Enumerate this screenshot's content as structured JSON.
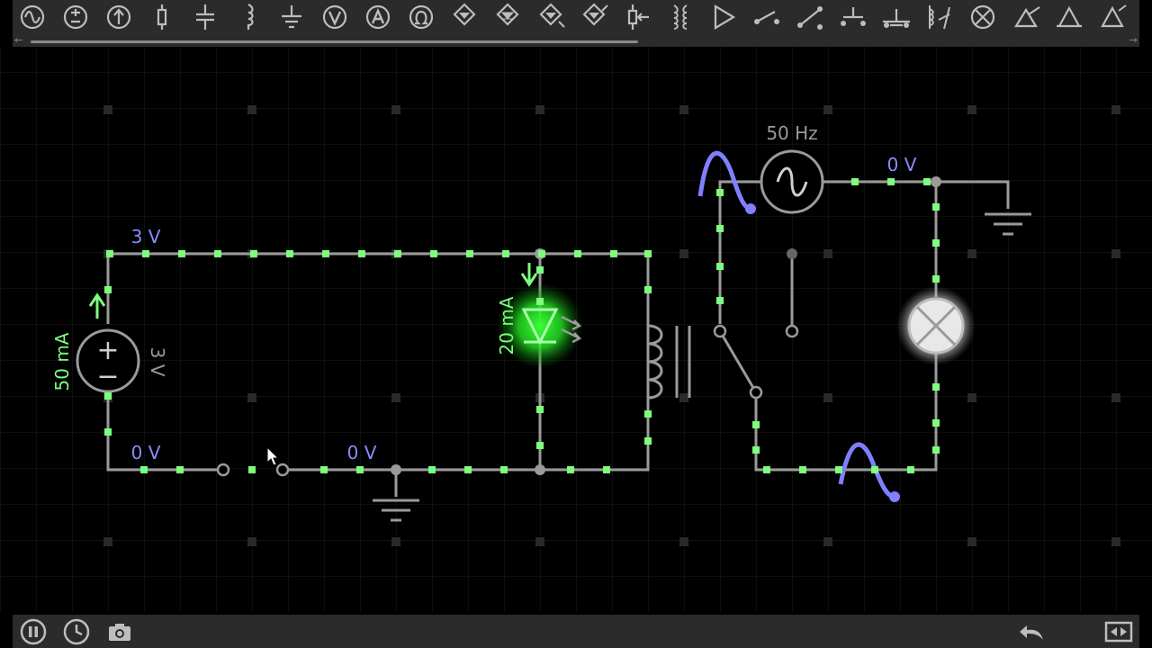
{
  "toolbar": {
    "tools": [
      {
        "icon": "ac-source-icon"
      },
      {
        "icon": "dc-voltage-source-icon"
      },
      {
        "icon": "current-source-icon"
      },
      {
        "icon": "resistor-icon"
      },
      {
        "icon": "capacitor-icon"
      },
      {
        "icon": "inductor-icon"
      },
      {
        "icon": "ground-icon"
      },
      {
        "icon": "voltmeter-icon"
      },
      {
        "icon": "ammeter-icon"
      },
      {
        "icon": "ohmmeter-icon"
      },
      {
        "icon": "diode-icon"
      },
      {
        "icon": "zener-diode-icon"
      },
      {
        "icon": "led-icon"
      },
      {
        "icon": "photodiode-icon"
      },
      {
        "icon": "potentiometer-icon"
      },
      {
        "icon": "transformer-icon"
      },
      {
        "icon": "buffer-icon"
      },
      {
        "icon": "spst-switch-icon"
      },
      {
        "icon": "spdt-switch-icon"
      },
      {
        "icon": "push-button-icon"
      },
      {
        "icon": "push-button-nc-icon"
      },
      {
        "icon": "relay-icon"
      },
      {
        "icon": "lamp-icon"
      },
      {
        "icon": "npn-transistor-icon"
      },
      {
        "icon": "pnp-transistor-icon"
      },
      {
        "icon": "mosfet-icon"
      }
    ]
  },
  "circuit": {
    "dc_source": {
      "current": "50 mA",
      "voltage": "3 V"
    },
    "led": {
      "current": "20 mA"
    },
    "ac_source": {
      "frequency": "50 Hz"
    },
    "node_labels": {
      "top_left": "3 V",
      "bottom_left": "0 V",
      "bottom_mid": "0 V",
      "ac_right": "0 V"
    }
  },
  "bottom_bar": {
    "left": [
      {
        "icon": "pause-icon"
      },
      {
        "icon": "clock-icon"
      },
      {
        "icon": "camera-icon"
      }
    ],
    "right": [
      {
        "icon": "undo-icon"
      },
      {
        "icon": "fit-screen-icon"
      }
    ]
  },
  "colors": {
    "wire": "#9a9a9a",
    "current_dot": "#7dff7d",
    "voltage_label": "#8b8bff",
    "led_glow": "#27e627",
    "ac_wave": "#7f7fff"
  }
}
